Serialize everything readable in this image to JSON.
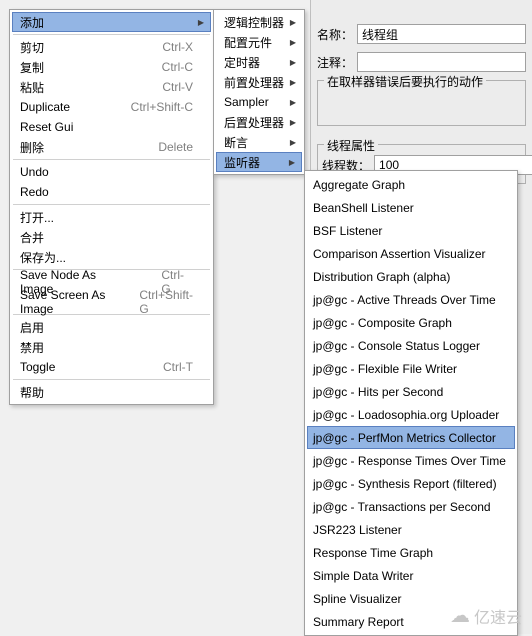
{
  "menu1": {
    "items": [
      {
        "label": "添加",
        "shortcut": "",
        "sub": true,
        "hl": true
      },
      {
        "sep": true
      },
      {
        "label": "剪切",
        "shortcut": "Ctrl-X"
      },
      {
        "label": "复制",
        "shortcut": "Ctrl-C"
      },
      {
        "label": "粘贴",
        "shortcut": "Ctrl-V"
      },
      {
        "label": "Duplicate",
        "shortcut": "Ctrl+Shift-C"
      },
      {
        "label": "Reset Gui",
        "shortcut": ""
      },
      {
        "label": "删除",
        "shortcut": "Delete"
      },
      {
        "sep": true
      },
      {
        "label": "Undo",
        "shortcut": ""
      },
      {
        "label": "Redo",
        "shortcut": ""
      },
      {
        "sep": true
      },
      {
        "label": "打开...",
        "shortcut": ""
      },
      {
        "label": "合并",
        "shortcut": ""
      },
      {
        "label": "保存为...",
        "shortcut": ""
      },
      {
        "sep": true
      },
      {
        "label": "Save Node As Image",
        "shortcut": "Ctrl-G"
      },
      {
        "label": "Save Screen As Image",
        "shortcut": "Ctrl+Shift-G"
      },
      {
        "sep": true
      },
      {
        "label": "启用",
        "shortcut": ""
      },
      {
        "label": "禁用",
        "shortcut": ""
      },
      {
        "label": "Toggle",
        "shortcut": "Ctrl-T"
      },
      {
        "sep": true
      },
      {
        "label": "帮助",
        "shortcut": ""
      }
    ]
  },
  "menu2": {
    "items": [
      {
        "label": "逻辑控制器",
        "sub": true
      },
      {
        "label": "配置元件",
        "sub": true
      },
      {
        "label": "定时器",
        "sub": true
      },
      {
        "label": "前置处理器",
        "sub": true
      },
      {
        "label": "Sampler",
        "sub": true
      },
      {
        "label": "后置处理器",
        "sub": true
      },
      {
        "label": "断言",
        "sub": true
      },
      {
        "label": "监听器",
        "sub": true,
        "hl": true
      }
    ]
  },
  "menu3": {
    "items": [
      {
        "label": "Aggregate Graph"
      },
      {
        "label": "BeanShell Listener"
      },
      {
        "label": "BSF Listener"
      },
      {
        "label": "Comparison Assertion Visualizer"
      },
      {
        "label": "Distribution Graph (alpha)"
      },
      {
        "label": "jp@gc - Active Threads Over Time"
      },
      {
        "label": "jp@gc - Composite Graph"
      },
      {
        "label": "jp@gc - Console Status Logger"
      },
      {
        "label": "jp@gc - Flexible File Writer"
      },
      {
        "label": "jp@gc - Hits per Second"
      },
      {
        "label": "jp@gc - Loadosophia.org Uploader"
      },
      {
        "label": "jp@gc - PerfMon Metrics Collector",
        "hl": true
      },
      {
        "label": "jp@gc - Response Times Over Time"
      },
      {
        "label": "jp@gc - Synthesis Report (filtered)"
      },
      {
        "label": "jp@gc - Transactions per Second"
      },
      {
        "label": "JSR223 Listener"
      },
      {
        "label": "Response Time Graph"
      },
      {
        "label": "Simple Data Writer"
      },
      {
        "label": "Spline Visualizer"
      },
      {
        "label": "Summary Report"
      }
    ]
  },
  "form": {
    "name_label": "名称：",
    "name_value": "线程组",
    "comment_label": "注释：",
    "group1_legend": "在取样器错误后要执行的动作",
    "group2_legend": "线程属性",
    "threads_label": "线程数：",
    "threads_value": "100"
  },
  "watermark": "亿速云"
}
